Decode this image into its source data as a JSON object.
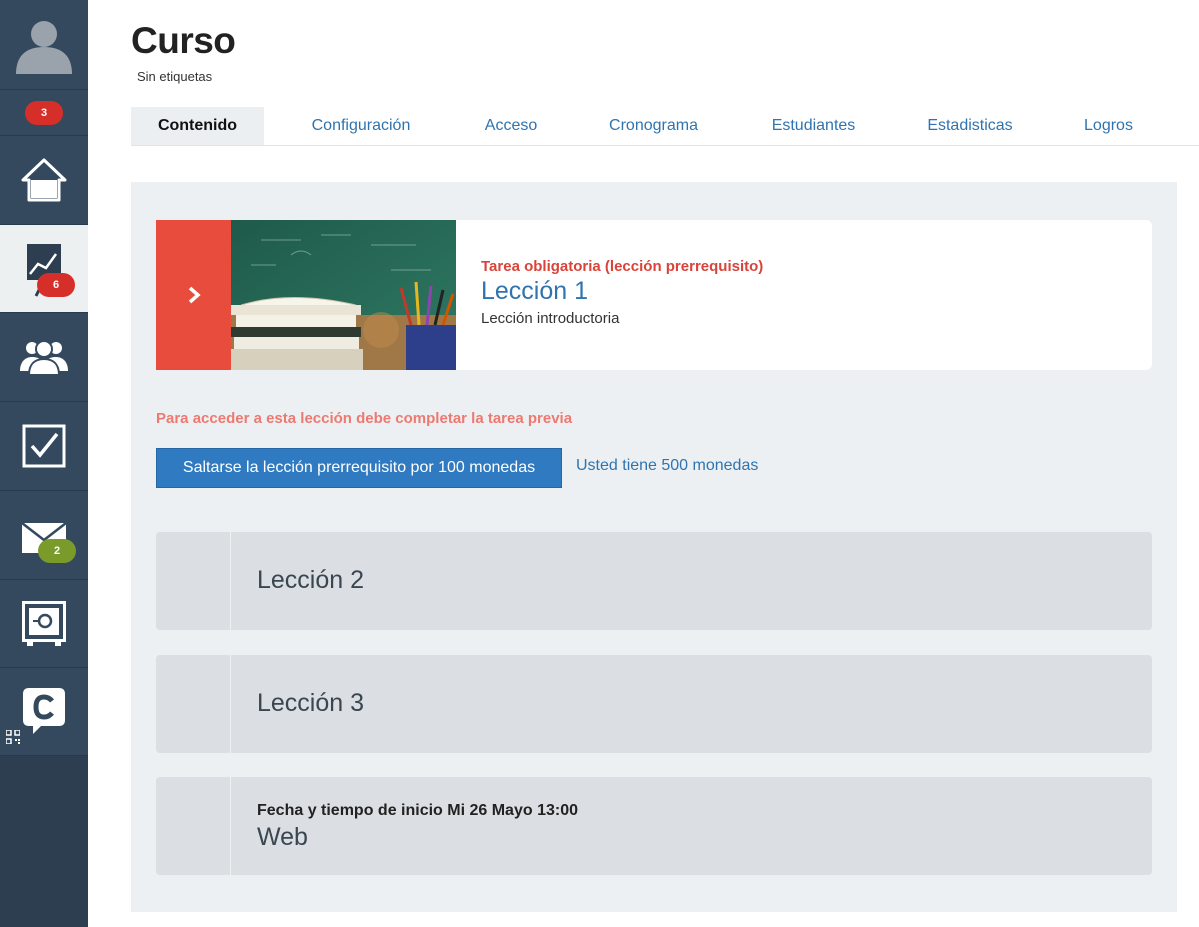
{
  "sidebar": {
    "notifications_badge": "3",
    "course_badge": "6",
    "mail_badge": "2",
    "icons": [
      "avatar-icon",
      "home-icon",
      "chart-board-icon",
      "users-icon",
      "checkbox-icon",
      "mail-icon",
      "safe-icon",
      "chat-logo-icon",
      "qr-code-icon"
    ]
  },
  "header": {
    "title": "Curso",
    "tags": "Sin etiquetas"
  },
  "tabs": [
    {
      "label": "Contenido",
      "active": true
    },
    {
      "label": "Configuración",
      "active": false
    },
    {
      "label": "Acceso",
      "active": false
    },
    {
      "label": "Cronograma",
      "active": false
    },
    {
      "label": "Estudiantes",
      "active": false
    },
    {
      "label": "Estadisticas",
      "active": false
    },
    {
      "label": "Logros",
      "active": false
    }
  ],
  "lesson1": {
    "requirement": "Tarea obligatoria (lección prerrequisito)",
    "title": "Lección 1",
    "subtitle": "Lección introductoria"
  },
  "access": {
    "message": "Para acceder a esta lección debe completar la tarea previa",
    "skip_button": "Saltarse la lección prerrequisito por 100 monedas",
    "coins": "Usted tiene 500 monedas"
  },
  "locked_lessons": [
    {
      "title": "Lección 2"
    },
    {
      "title": "Lección 3"
    },
    {
      "date": "Fecha y tiempo de inicio Mi 26 Mayo 13:00",
      "title": "Web"
    }
  ],
  "colors": {
    "sidebar": "#34495e",
    "accent_red": "#e74c3c",
    "link_blue": "#2f74b0",
    "button_blue": "#2f7ac0"
  }
}
